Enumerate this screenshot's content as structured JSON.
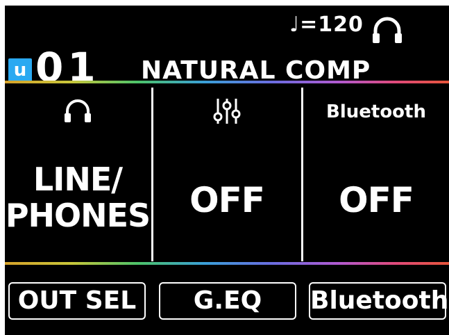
{
  "header": {
    "tempo": "♩=120",
    "output_icon": "headphones-icon"
  },
  "patch": {
    "bank_letter": "u",
    "number": "01",
    "name": "NATURAL COMP"
  },
  "columns": [
    {
      "header_icon": "headphones-icon",
      "value": "LINE/\nPHONES"
    },
    {
      "header_icon": "equalizer-icon",
      "value": "OFF"
    },
    {
      "header_text": "Bluetooth",
      "value": "OFF"
    }
  ],
  "buttons": [
    {
      "label": "OUT SEL"
    },
    {
      "label": "G.EQ"
    },
    {
      "label": "Bluetooth"
    }
  ],
  "colors": {
    "background": "#000000",
    "foreground": "#ffffff",
    "bank_badge": "#2aa9f1"
  }
}
